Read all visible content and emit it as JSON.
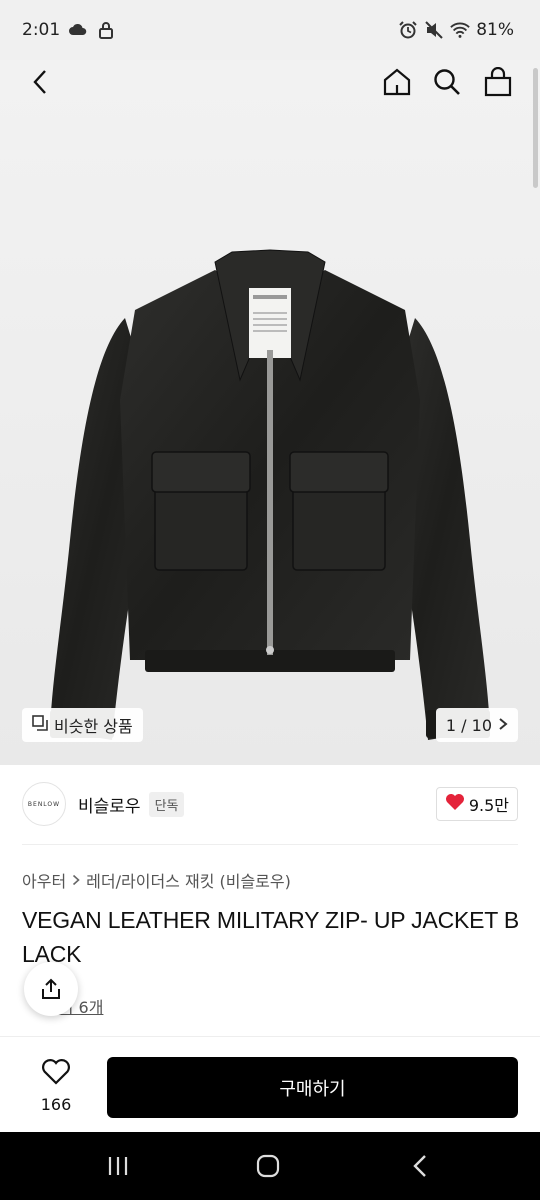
{
  "status_bar": {
    "time": "2:01",
    "battery": "81%"
  },
  "gallery": {
    "similar_label": "비슷한 상품",
    "page_counter": "1 / 10",
    "tag_brand_text": "BENLOW"
  },
  "brand": {
    "logo_text": "BENLOW",
    "name": "비슬로우",
    "badge": "단독",
    "like_count": "9.5만"
  },
  "breadcrumb": {
    "level1": "아우터",
    "level2": "레더/라이더스 재킷 (비슬로우)"
  },
  "product": {
    "title": "VEGAN LEATHER MILITARY ZIP- UP JACKET BLACK"
  },
  "reviews": {
    "label": "후기 6개"
  },
  "bottom_bar": {
    "like_count": "166",
    "buy_label": "구매하기"
  },
  "colors": {
    "heart": "#e4233a",
    "buy_button": "#000000",
    "hero_bg": "#eeeeee"
  }
}
